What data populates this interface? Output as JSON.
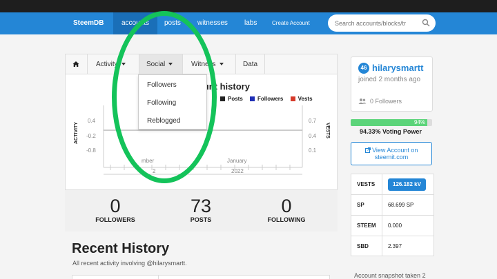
{
  "navbar": {
    "brand": "SteemDB",
    "items": [
      "accounts",
      "posts",
      "witnesses",
      "labs",
      "Create Account"
    ],
    "search_placeholder": "Search accounts/blocks/tr"
  },
  "tabs": {
    "home_icon": "home-icon",
    "activity": "Activity",
    "social": "Social",
    "witness": "Witness",
    "data": "Data"
  },
  "social_dropdown": [
    "Followers",
    "Following",
    "Reblogged"
  ],
  "chart": {
    "title": "Account history",
    "legend": [
      {
        "name": "Posts",
        "color": "#222222"
      },
      {
        "name": "Followers",
        "color": "#1f2fb5"
      },
      {
        "name": "Vests",
        "color": "#d63a2a"
      }
    ],
    "left_axis_label": "ACTIVITY",
    "right_axis_label": "VESTS",
    "left_ticks": [
      "0.4",
      "-0.2",
      "-0.8"
    ],
    "right_ticks": [
      "0.7",
      "0.4",
      "0.1"
    ],
    "x_labels": [
      "mber",
      "January"
    ],
    "x_sublabels": [
      "2",
      "2022"
    ]
  },
  "stats": [
    {
      "value": "0",
      "label": "FOLLOWERS"
    },
    {
      "value": "73",
      "label": "POSTS"
    },
    {
      "value": "0",
      "label": "FOLLOWING"
    }
  ],
  "recent": {
    "title": "Recent History",
    "subtitle": "All recent activity involving @hilarysmartt."
  },
  "profile": {
    "reputation": "46",
    "username": "hilarysmartt",
    "joined": "joined 2 months ago",
    "followers": "0 Followers",
    "voting_power_pct": 94.33,
    "voting_power_badge": "94%",
    "voting_power_text": "94.33% Voting Power",
    "view_line1": "View Account on",
    "view_line2": "steemit.com"
  },
  "values": [
    {
      "key": "VESTS",
      "value": "126.182 kV"
    },
    {
      "key": "SP",
      "value": "68.699 SP"
    },
    {
      "key": "STEEM",
      "value": "0.000"
    },
    {
      "key": "SBD",
      "value": "2.397"
    }
  ],
  "snapshot": "Account snapshot taken 2",
  "colors": {
    "navbar": "#2486d6",
    "accent": "#2486d6",
    "highlight_ring": "#14c35a",
    "voting_bar": "#5cd47a"
  }
}
